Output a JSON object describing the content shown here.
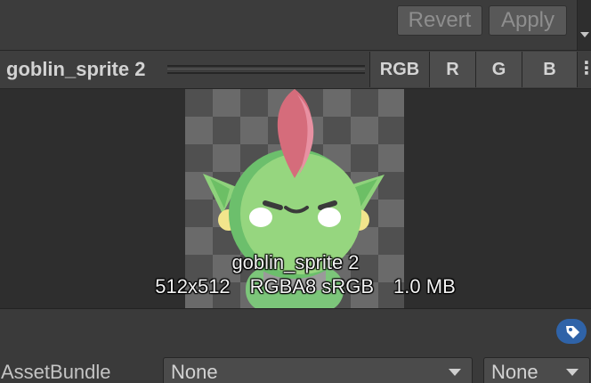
{
  "toolbar": {
    "revert_label": "Revert",
    "apply_label": "Apply"
  },
  "preview_header": {
    "asset_name": "goblin_sprite 2",
    "channels": [
      "RGB",
      "R",
      "G",
      "B"
    ],
    "more_icon": "kebab-menu-icon"
  },
  "preview": {
    "name": "goblin_sprite 2",
    "dimensions": "512x512",
    "format": "RGBA8 sRGB",
    "size": "1.0 MB"
  },
  "asset_bundle": {
    "label": "AssetBundle",
    "bundle_value": "None",
    "variant_value": "None",
    "tag_icon": "tag-icon"
  },
  "colors": {
    "accent": "#2f63a8",
    "goblin_skin": "#8cd27a",
    "mohawk": "#d9707f"
  }
}
